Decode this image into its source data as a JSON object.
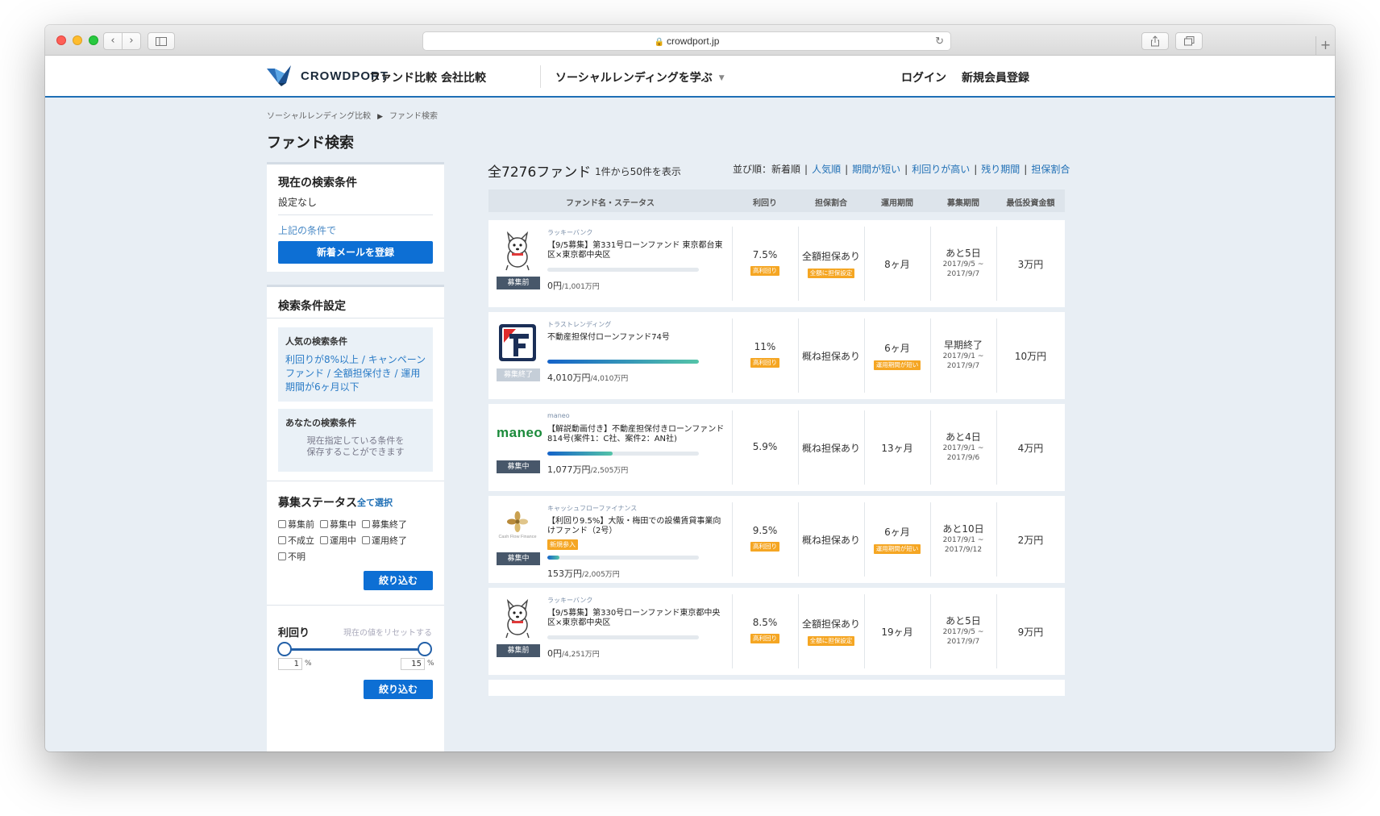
{
  "browser": {
    "url": "crowdport.jp",
    "lock_icon": "lock-icon",
    "reload_icon": "reload-icon"
  },
  "header": {
    "logo_text": "CROWDPORT",
    "nav": [
      "ファンド比較",
      "会社比較",
      "ソーシャルレンディングを学ぶ"
    ],
    "login": "ログイン",
    "signup": "新規会員登録",
    "accent_color": "#1f6fb5"
  },
  "breadcrumb": [
    "ソーシャルレンディング比較",
    "ファンド検索"
  ],
  "page_title": "ファンド検索",
  "sidebar": {
    "current": {
      "title": "現在の検索条件",
      "value": "設定なし",
      "condition_label": "上記の条件で",
      "register_button": "新着メールを登録"
    },
    "settings": {
      "title": "検索条件設定",
      "popular_title": "人気の検索条件",
      "popular_link": "利回りが8%以上 / キャンペーンファンド / 全額担保付き / 運用期間が6ヶ月以下",
      "yours_title": "あなたの検索条件",
      "yours_desc_1": "現在指定している条件を",
      "yours_desc_2": "保存することができます",
      "status_title": "募集ステータス",
      "select_all": "全て選択",
      "checkboxes": [
        "募集前",
        "募集中",
        "募集終了",
        "不成立",
        "運用中",
        "運用終了",
        "不明"
      ],
      "filter_button": "絞り込む",
      "rate_title": "利回り",
      "rate_reset": "現在の値をリセットする",
      "rate_min": "1",
      "rate_max": "15",
      "rate_unit": "%",
      "filter_button_2": "絞り込む"
    }
  },
  "results": {
    "count": "全7276ファンド",
    "range": "1件から50件を表示",
    "sort_label": "並び順：新着順",
    "sort_links": [
      "人気順",
      "期間が短い",
      "利回りが高い",
      "残り期間",
      "担保割合"
    ],
    "columns": [
      "ファンド名・ステータス",
      "利回り",
      "担保割合",
      "運用期間",
      "募集期間",
      "最低投資金額"
    ],
    "rows": [
      {
        "company": "ラッキーバンク",
        "name": "【9/5募集】第331号ローンファンド 東京都台東区×東京都中央区",
        "status": "募集前",
        "progress": 0,
        "raised": "0円",
        "target": "/1,001万円",
        "yield": "7.5%",
        "yield_tag": "高利回り",
        "collateral": "全額担保あり",
        "collateral_tag": "全額に担保設定",
        "term": "8ヶ月",
        "term_tag": "",
        "period": "あと5日",
        "period_start": "2017/9/5 ~",
        "period_end": "2017/9/7",
        "min": "3万円",
        "logo": "dog-logo",
        "new_badge": ""
      },
      {
        "company": "トラストレンディング",
        "name": "不動産担保付ローンファンド74号",
        "status": "募集終了",
        "progress": 1,
        "raised": "4,010万円",
        "target": "/4,010万円",
        "yield": "11%",
        "yield_tag": "高利回り",
        "collateral": "概ね担保あり",
        "collateral_tag": "",
        "term": "6ヶ月",
        "term_tag": "運用期間が短い",
        "period": "早期終了",
        "period_start": "2017/9/1 ~",
        "period_end": "2017/9/7",
        "min": "10万円",
        "logo": "trust-lending-logo",
        "new_badge": ""
      },
      {
        "company": "maneo",
        "name": "【解説動画付き】不動産担保付きローンファンド814号(案件1：C社、案件2：AN社)",
        "status": "募集中",
        "progress": 0.43,
        "raised": "1,077万円",
        "target": "/2,505万円",
        "yield": "5.9%",
        "yield_tag": "",
        "collateral": "概ね担保あり",
        "collateral_tag": "",
        "term": "13ヶ月",
        "term_tag": "",
        "period": "あと4日",
        "period_start": "2017/9/1 ~",
        "period_end": "2017/9/6",
        "min": "4万円",
        "logo": "maneo-logo",
        "logo_text": "maneo",
        "new_badge": ""
      },
      {
        "company": "キャッシュフローファイナンス",
        "name": "【利回り9.5%】大阪・梅田での設備賃貸事業向けファンド（2号）",
        "status": "募集中",
        "progress": 0.08,
        "raised": "153万円",
        "target": "/2,005万円",
        "yield": "9.5%",
        "yield_tag": "高利回り",
        "collateral": "概ね担保あり",
        "collateral_tag": "",
        "term": "6ヶ月",
        "term_tag": "運用期間が短い",
        "period": "あと10日",
        "period_start": "2017/9/1 ~",
        "period_end": "2017/9/12",
        "min": "2万円",
        "logo": "cash-flow-finance-logo",
        "logo_text": "Cash Flow Finance",
        "new_badge": "新規参入"
      },
      {
        "company": "ラッキーバンク",
        "name": "【9/5募集】第330号ローンファンド東京都中央区×東京都中央区",
        "status": "募集前",
        "progress": 0,
        "raised": "0円",
        "target": "/4,251万円",
        "yield": "8.5%",
        "yield_tag": "高利回り",
        "collateral": "全額担保あり",
        "collateral_tag": "全額に担保設定",
        "term": "19ヶ月",
        "term_tag": "",
        "period": "あと5日",
        "period_start": "2017/9/5 ~",
        "period_end": "2017/9/7",
        "min": "9万円",
        "logo": "dog-logo",
        "new_badge": ""
      }
    ]
  }
}
